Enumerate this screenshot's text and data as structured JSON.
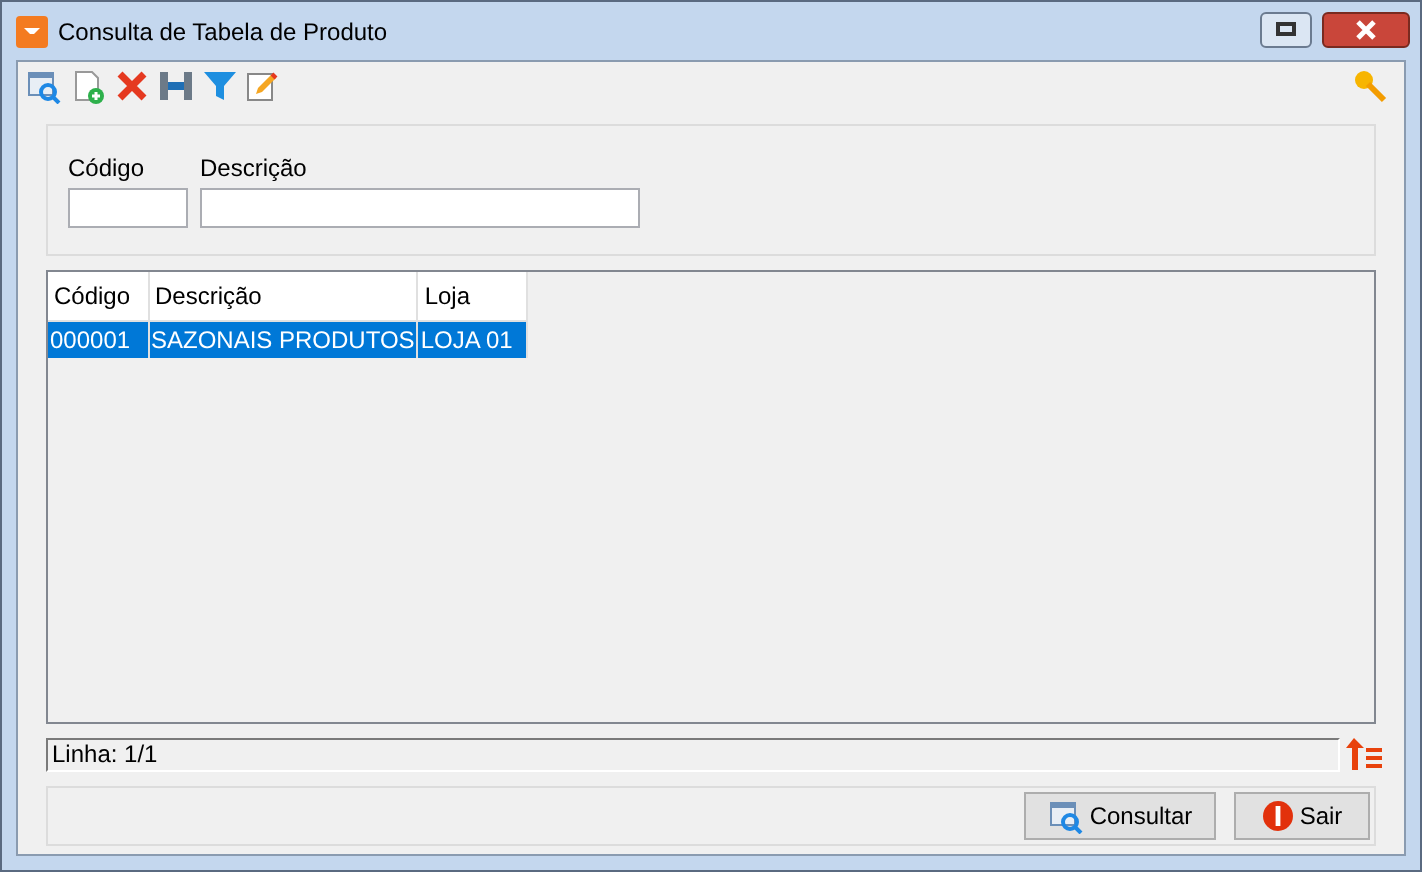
{
  "window": {
    "title": "Consulta de Tabela de Produto"
  },
  "filters": [
    {
      "label": "Código"
    },
    {
      "label": "Descrição"
    }
  ],
  "table": {
    "columns": [
      "Código",
      "Descrição",
      "Loja"
    ],
    "rows": [
      {
        "cells": [
          "000001",
          "SAZONAIS PRODUTOS",
          "LOJA 01"
        ],
        "selected": true
      }
    ]
  },
  "status_bar": {
    "text": "Linha: 1/1"
  },
  "buttons": [
    {
      "label": "Consultar",
      "kind": "search"
    },
    {
      "label": "Sair",
      "kind": "exit"
    }
  ]
}
